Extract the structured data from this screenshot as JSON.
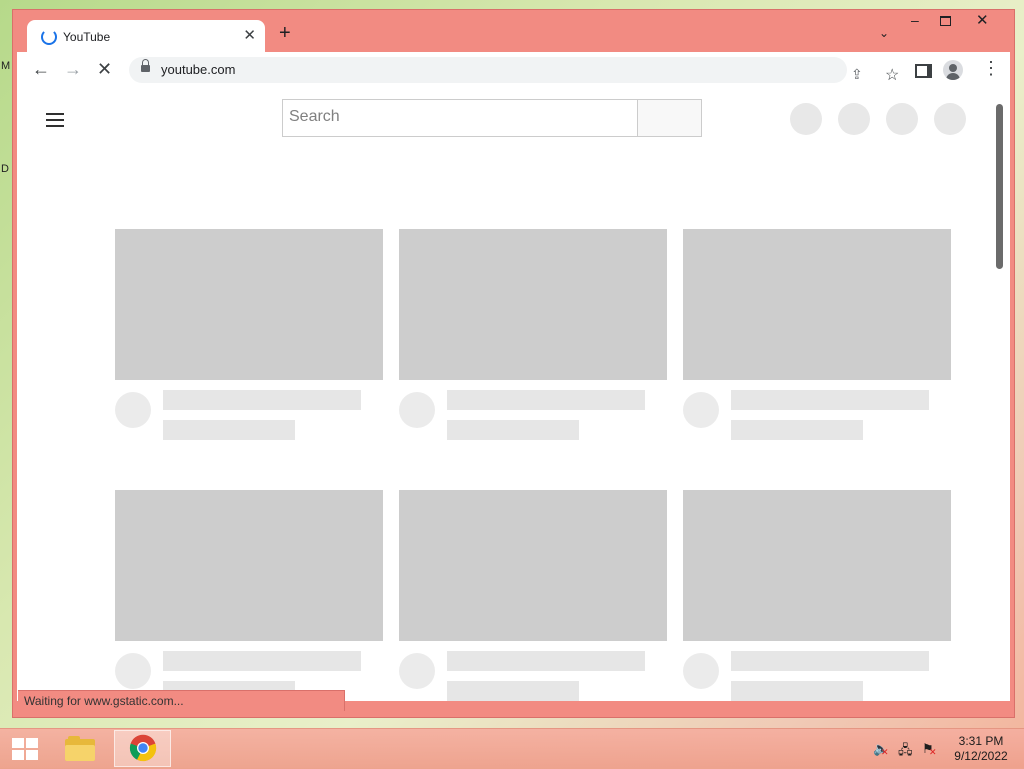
{
  "browser": {
    "tab": {
      "title": "YouTube"
    },
    "address": {
      "url": "youtube.com"
    },
    "status_text": "Waiting for www.gstatic.com..."
  },
  "page": {
    "search": {
      "placeholder": "Search"
    },
    "video_rows": 2,
    "video_cols": 3
  },
  "taskbar": {
    "clock_time": "3:31 PM",
    "clock_date": "9/12/2022",
    "pinned": [
      {
        "name": "start",
        "icon": "windows-logo-icon"
      },
      {
        "name": "file-explorer",
        "icon": "folder-icon"
      },
      {
        "name": "chrome",
        "icon": "chrome-icon",
        "active": true
      }
    ],
    "tray_icons": [
      "volume-muted-icon",
      "network-disconnected-icon",
      "action-center-flag-icon"
    ]
  },
  "desktop": {
    "edge_chars": [
      "M",
      "D"
    ]
  },
  "colors": {
    "window_frame": "#f28b82",
    "placeholder_thumb": "#cdcdcd",
    "placeholder_line": "#e6e6e6",
    "spinner": "#1a73e8"
  }
}
